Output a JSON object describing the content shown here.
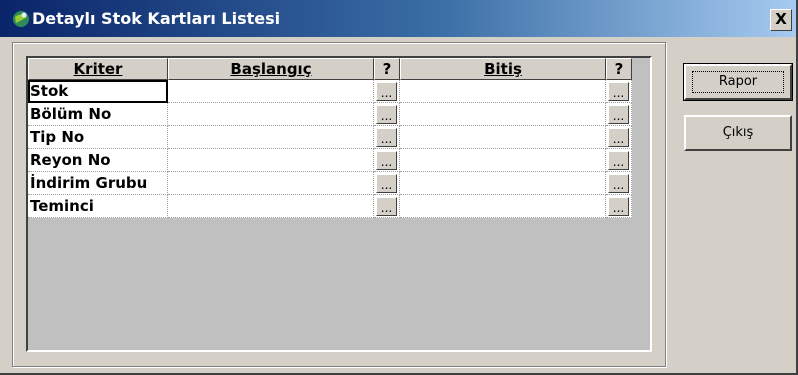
{
  "window": {
    "title": "Detaylı Stok Kartları Listesi",
    "close_label": "X"
  },
  "grid": {
    "headers": {
      "kriter": "Kriter",
      "baslangic": "Başlangıç",
      "q1": "?",
      "bitis": "Bitiş",
      "q2": "?"
    },
    "rows": [
      {
        "kriter": "Stok",
        "button": "..."
      },
      {
        "kriter": "Bölüm No",
        "button": "..."
      },
      {
        "kriter": "Tip No",
        "button": "..."
      },
      {
        "kriter": "Reyon No",
        "button": "..."
      },
      {
        "kriter": "İndirim Grubu",
        "button": "..."
      },
      {
        "kriter": "Teminci",
        "button": "..."
      }
    ]
  },
  "buttons": {
    "rapor": "Rapor",
    "cikis": "Çıkış"
  },
  "colors": {
    "titlebar_start": "#0a246a",
    "titlebar_end": "#a6caf0",
    "face": "#d4d0c8"
  }
}
